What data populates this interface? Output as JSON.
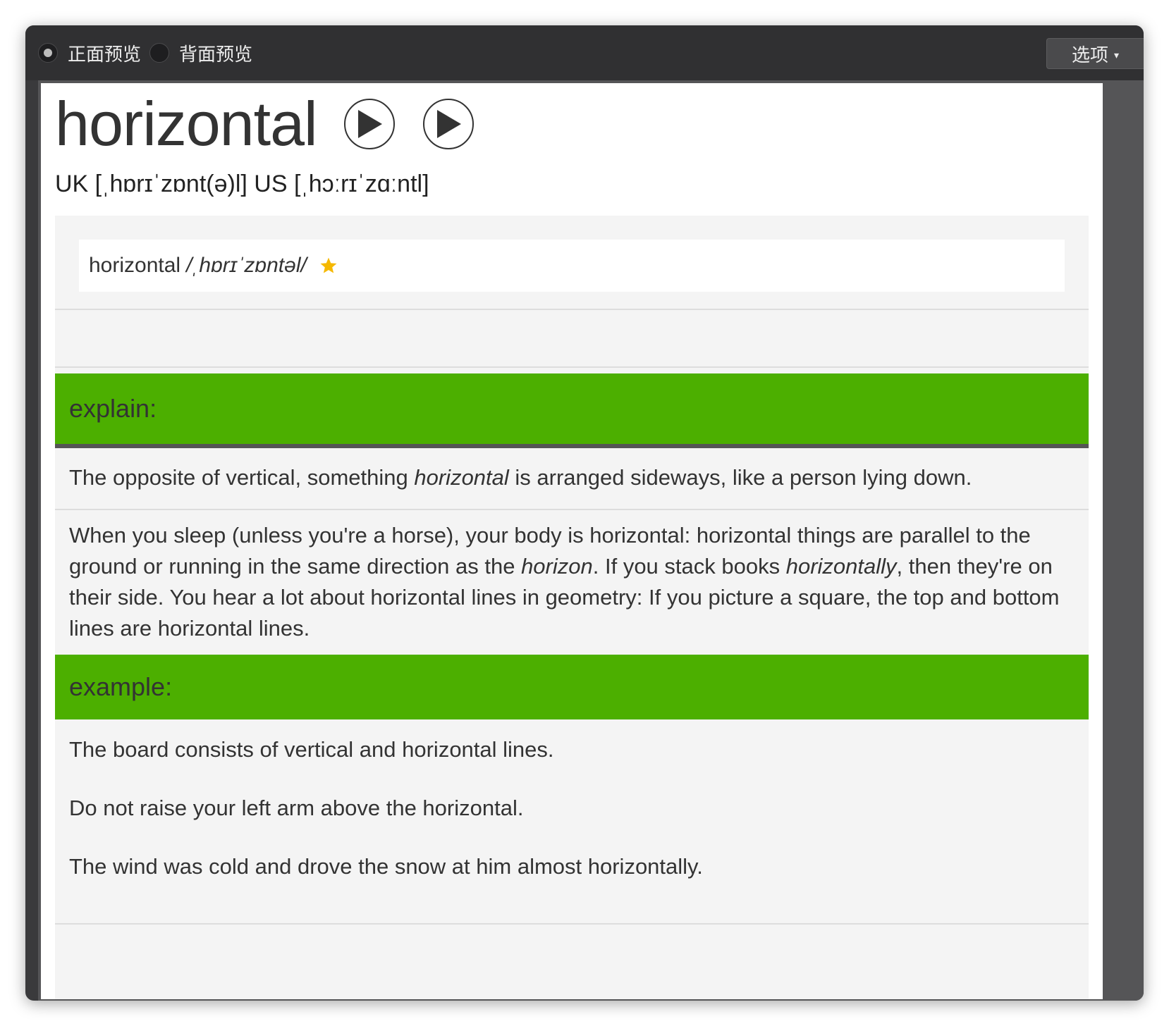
{
  "toolbar": {
    "front_preview": "正面预览",
    "back_preview": "背面预览",
    "options_label": "选项",
    "options_caret": "▾",
    "selected": "front"
  },
  "card": {
    "headword": "horizontal",
    "play_buttons": [
      "play-uk",
      "play-us"
    ],
    "phonetics": "UK [ˌhɒrɪˈzɒnt(ə)l] US [ˌhɔːrɪˈzɑːntl]",
    "dict_entry": {
      "word": "horizontal",
      "ipa": "/ˌhɒrɪˈzɒntəl/",
      "star_color": "#f5b800"
    },
    "explain": {
      "header": "explain:",
      "short_pre": "The opposite of vertical, something ",
      "short_em": "horizontal",
      "short_post": " is arranged sideways, like a person lying down.",
      "long_1": "When you sleep (unless you're a horse), your body is horizontal: horizontal things are parallel to the ground or running in the same direction as the ",
      "long_em1": "horizon",
      "long_2": ". If you stack books ",
      "long_em2": "horizontally",
      "long_3": ", then they're on their side. You hear a lot about horizontal lines in geometry: If you picture a square, the top and bottom lines are horizontal lines."
    },
    "example": {
      "header": "example:",
      "sentences": [
        "The board consists of vertical and horizontal lines.",
        "Do not raise your left arm above the horizontal.",
        "The wind was cold and drove the snow at him almost horizontally."
      ]
    }
  },
  "colors": {
    "section_header_bg": "#4caf00",
    "window_bg": "#303032",
    "panel_bg": "#f4f4f4"
  }
}
